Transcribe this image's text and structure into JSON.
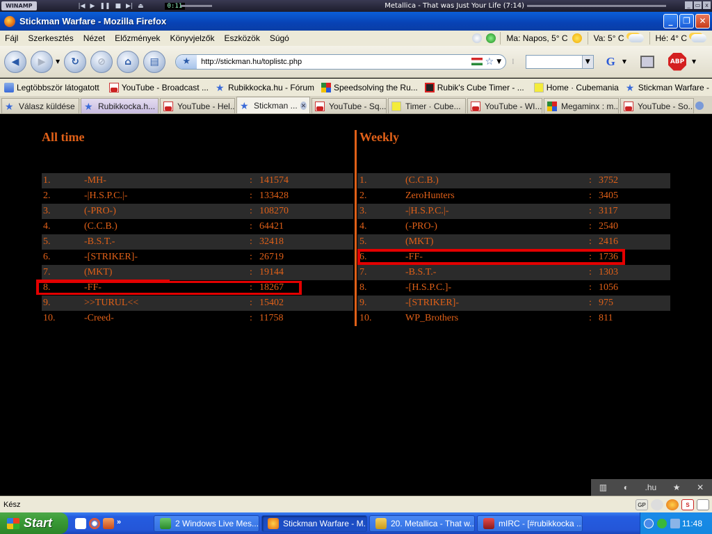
{
  "winamp": {
    "logo": "WINAMP",
    "time": "0:11",
    "now_playing": "Metallica - That was Just Your Life (7:14)"
  },
  "window": {
    "title": "Stickman Warfare - Mozilla Firefox"
  },
  "menubar": {
    "items": [
      "Fájl",
      "Szerkesztés",
      "Nézet",
      "Előzmények",
      "Könyvjelzők",
      "Eszközök",
      "Súgó"
    ],
    "weather": [
      "Ma: Napos, 5° C",
      "Va: 5° C",
      "Hé: 4° C"
    ]
  },
  "navbar": {
    "url": "http://stickman.hu/toplistc.php",
    "abp_label": "ABP"
  },
  "bookmarks": [
    {
      "label": "Legtöbbször látogatott",
      "icon": "folder-icon"
    },
    {
      "label": "YouTube - Broadcast ...",
      "icon": "youtube-icon"
    },
    {
      "label": "Rubikkocka.hu - Fórum",
      "icon": "star-icon"
    },
    {
      "label": "Speedsolving the Ru...",
      "icon": "cube-icon"
    },
    {
      "label": "Rubik's Cube Timer - ...",
      "icon": "cube-timer-icon"
    },
    {
      "label": "Home · Cubemania",
      "icon": "cubemania-icon"
    },
    {
      "label": "Stickman Warfare - F...",
      "icon": "star-icon"
    }
  ],
  "tabs": [
    {
      "label": "Válasz küldése",
      "icon": "star-icon",
      "width": 112
    },
    {
      "label": "Rubikkocka.h...",
      "icon": "star-icon",
      "width": 112
    },
    {
      "label": "YouTube - Hel...",
      "icon": "youtube-icon",
      "width": 108
    },
    {
      "label": "Stickman ...",
      "icon": "star-icon",
      "width": 106,
      "active": true
    },
    {
      "label": "YouTube - Sq...",
      "icon": "youtube-icon",
      "width": 108
    },
    {
      "label": "Timer · Cube...",
      "icon": "cubemania-icon",
      "width": 112
    },
    {
      "label": "YouTube - WI...",
      "icon": "youtube-icon",
      "width": 108
    },
    {
      "label": "Megaminx : m...",
      "icon": "cube-icon",
      "width": 108
    },
    {
      "label": "YouTube - So...",
      "icon": "youtube-icon",
      "width": 106
    }
  ],
  "leaderboard": {
    "alltime_title": "All time",
    "weekly_title": "Weekly",
    "separator": ":",
    "alltime": [
      {
        "rank": "1.",
        "name": "-MH-",
        "score": "141574"
      },
      {
        "rank": "2.",
        "name": "-|H.S.P.C.|-",
        "score": "133428"
      },
      {
        "rank": "3.",
        "name": "(-PRO-)",
        "score": "108270"
      },
      {
        "rank": "4.",
        "name": "(C.C.B.)",
        "score": "64421"
      },
      {
        "rank": "5.",
        "name": "-B.S.T.-",
        "score": "32418"
      },
      {
        "rank": "6.",
        "name": "-[STRIKER]-",
        "score": "26719"
      },
      {
        "rank": "7.",
        "name": "(MKT)",
        "score": "19144"
      },
      {
        "rank": "8.",
        "name": "-FF-",
        "score": "18267"
      },
      {
        "rank": "9.",
        "name": ">>TURUL<<",
        "score": "15402"
      },
      {
        "rank": "10.",
        "name": "-Creed-",
        "score": "11758"
      }
    ],
    "weekly": [
      {
        "rank": "1.",
        "name": "(C.C.B.)",
        "score": "3752"
      },
      {
        "rank": "2.",
        "name": "ZeroHunters",
        "score": "3405"
      },
      {
        "rank": "3.",
        "name": "-|H.S.P.C.|-",
        "score": "3117"
      },
      {
        "rank": "4.",
        "name": "(-PRO-)",
        "score": "2540"
      },
      {
        "rank": "5.",
        "name": "(MKT)",
        "score": "2416"
      },
      {
        "rank": "6.",
        "name": "-FF-",
        "score": "1736"
      },
      {
        "rank": "7.",
        "name": "-B.S.T.-",
        "score": "1303"
      },
      {
        "rank": "8.",
        "name": "-[H.S.P.C.]-",
        "score": "1056"
      },
      {
        "rank": "9.",
        "name": "-[STRIKER]-",
        "score": "975"
      },
      {
        "rank": "10.",
        "name": "WP_Brothers",
        "score": "811"
      }
    ],
    "accent_color": "#e06018",
    "highlight_color": "#e40000"
  },
  "addonbar": {
    "hu_label": ".hu"
  },
  "statusbar": {
    "text": "Kész"
  },
  "taskbar": {
    "start_label": "Start",
    "tasks": [
      {
        "label": "2 Windows Live Mes...",
        "width": 152
      },
      {
        "label": "Stickman Warfare - M...",
        "width": 152,
        "active": true
      },
      {
        "label": "20. Metallica - That w...",
        "width": 152
      },
      {
        "label": "mIRC - [#rubikkocka ...",
        "width": 152
      }
    ],
    "clock": "11:48"
  }
}
